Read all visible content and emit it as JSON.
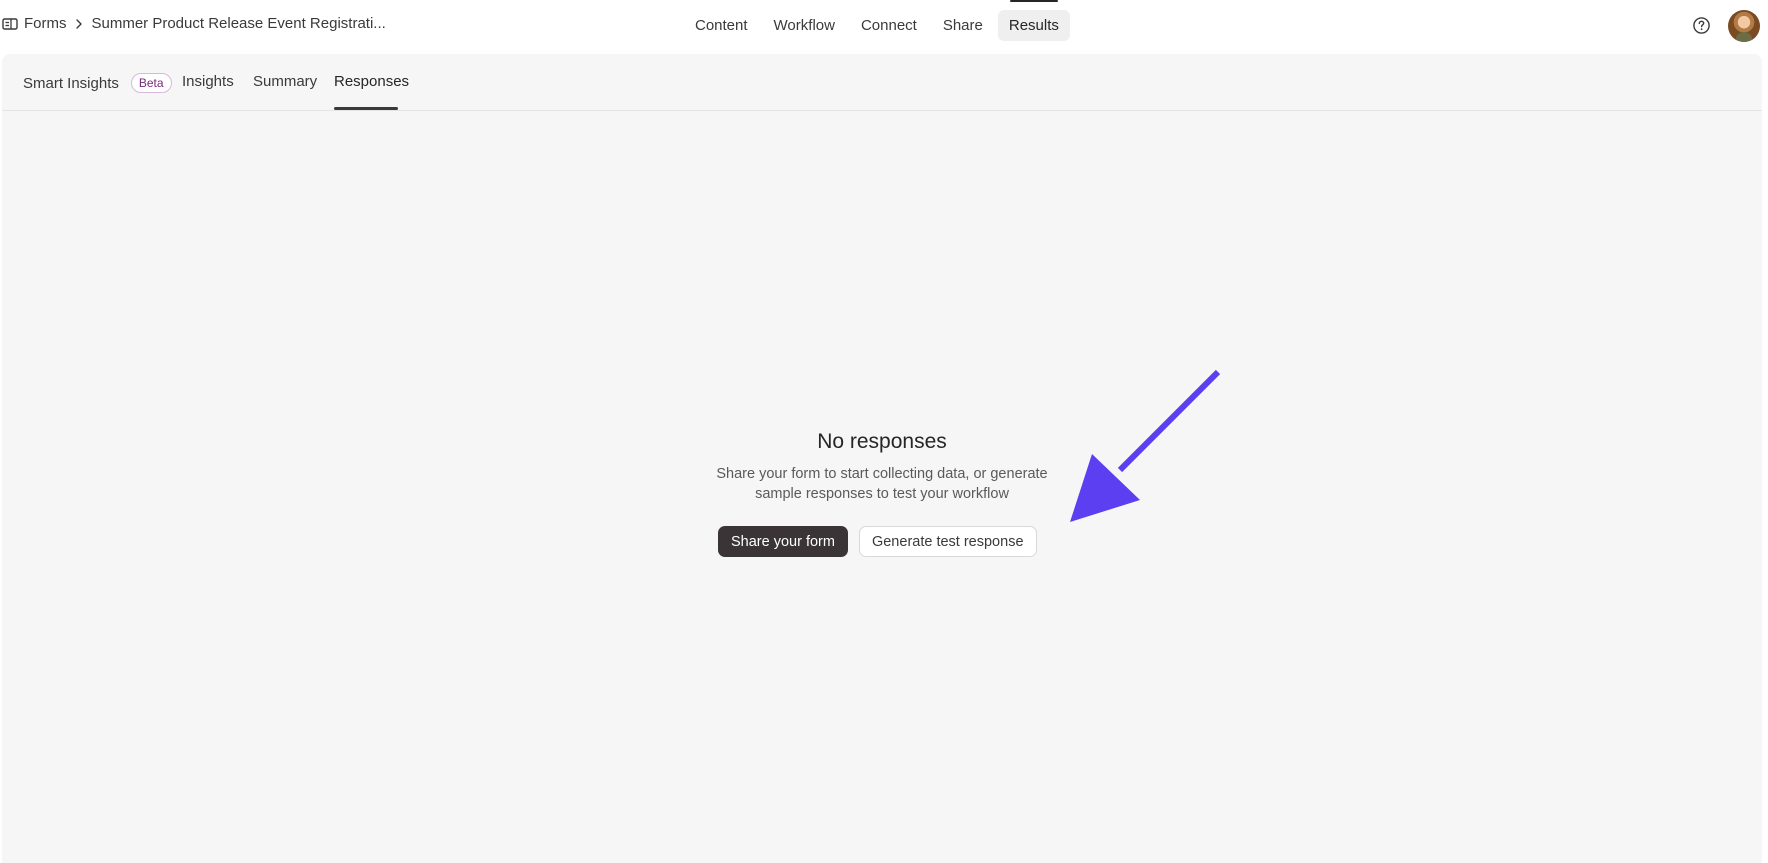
{
  "breadcrumb": {
    "root": "Forms",
    "current": "Summer Product Release Event Registrati..."
  },
  "topnav": {
    "items": [
      "Content",
      "Workflow",
      "Connect",
      "Share",
      "Results"
    ],
    "active": "Results"
  },
  "subtabs": {
    "smart_insights": "Smart Insights",
    "beta_badge": "Beta",
    "insights": "Insights",
    "summary": "Summary",
    "responses": "Responses",
    "active": "Responses"
  },
  "empty_state": {
    "title": "No responses",
    "description_line1": "Share your form to start collecting data, or generate",
    "description_line2": "sample responses to test your workflow",
    "primary_button": "Share your form",
    "secondary_button": "Generate test response"
  },
  "icons": {
    "breadcrumb": "form-icon",
    "separator": "chevron-right-icon",
    "help": "help-circle-icon",
    "avatar": "user-avatar",
    "annotation": "arrow-annotation"
  },
  "colors": {
    "annotation_arrow": "#5b3ff0",
    "primary_button": "#3b3437",
    "beta_badge_text": "#7a2a7e",
    "panel_background": "#f6f6f6"
  }
}
